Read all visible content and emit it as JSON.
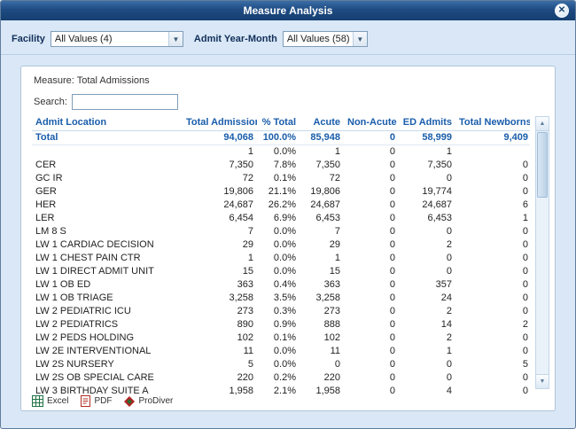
{
  "window": {
    "title": "Measure Analysis",
    "close_glyph": "✕"
  },
  "filters": {
    "facility_label": "Facility",
    "facility_value": "All Values (4)",
    "admit_label": "Admit Year-Month",
    "admit_value": "All Values (58)",
    "dropdown_arrow": "▼"
  },
  "panel": {
    "measure_label": "Measure: Total Admissions",
    "search_label": "Search:",
    "search_value": ""
  },
  "table": {
    "columns": [
      "Admit Location",
      "Total Admissions",
      "% Total",
      "Acute",
      "Non-Acute",
      "ED Admits",
      "Total Newborns"
    ],
    "total_row": [
      "Total",
      "94,068",
      "100.0%",
      "85,948",
      "0",
      "58,999",
      "9,409"
    ],
    "rows": [
      [
        "",
        "1",
        "0.0%",
        "1",
        "0",
        "1",
        ""
      ],
      [
        "CER",
        "7,350",
        "7.8%",
        "7,350",
        "0",
        "7,350",
        "0"
      ],
      [
        "GC IR",
        "72",
        "0.1%",
        "72",
        "0",
        "0",
        "0"
      ],
      [
        "GER",
        "19,806",
        "21.1%",
        "19,806",
        "0",
        "19,774",
        "0"
      ],
      [
        "HER",
        "24,687",
        "26.2%",
        "24,687",
        "0",
        "24,687",
        "6"
      ],
      [
        "LER",
        "6,454",
        "6.9%",
        "6,453",
        "0",
        "6,453",
        "1"
      ],
      [
        "LM 8 S",
        "7",
        "0.0%",
        "7",
        "0",
        "0",
        "0"
      ],
      [
        "LW 1 CARDIAC DECISION",
        "29",
        "0.0%",
        "29",
        "0",
        "2",
        "0"
      ],
      [
        "LW 1 CHEST PAIN CTR",
        "1",
        "0.0%",
        "1",
        "0",
        "0",
        "0"
      ],
      [
        "LW 1 DIRECT ADMIT UNIT",
        "15",
        "0.0%",
        "15",
        "0",
        "0",
        "0"
      ],
      [
        "LW 1 OB ED",
        "363",
        "0.4%",
        "363",
        "0",
        "357",
        "0"
      ],
      [
        "LW 1 OB TRIAGE",
        "3,258",
        "3.5%",
        "3,258",
        "0",
        "24",
        "0"
      ],
      [
        "LW 2 PEDIATRIC ICU",
        "273",
        "0.3%",
        "273",
        "0",
        "2",
        "0"
      ],
      [
        "LW 2 PEDIATRICS",
        "890",
        "0.9%",
        "888",
        "0",
        "14",
        "2"
      ],
      [
        "LW 2 PEDS HOLDING",
        "102",
        "0.1%",
        "102",
        "0",
        "2",
        "0"
      ],
      [
        "LW 2E INTERVENTIONAL",
        "11",
        "0.0%",
        "11",
        "0",
        "1",
        "0"
      ],
      [
        "LW 2S NURSERY",
        "5",
        "0.0%",
        "0",
        "0",
        "0",
        "5"
      ],
      [
        "LW 2S OB SPECIAL CARE",
        "220",
        "0.2%",
        "220",
        "0",
        "0",
        "0"
      ],
      [
        "LW 3 BIRTHDAY SUITE A",
        "1,958",
        "2.1%",
        "1,958",
        "0",
        "4",
        "0"
      ]
    ]
  },
  "scrollbar": {
    "up_glyph": "▲",
    "down_glyph": "▼"
  },
  "export": {
    "excel_label": "Excel",
    "pdf_label": "PDF",
    "prodiver_label": "ProDiver"
  },
  "colors": {
    "titlebar_blue": "#1e4b82",
    "accent_blue": "#1a5dab",
    "body_bg": "#d9e7f6",
    "panel_border": "#afc4d9",
    "excel_green": "#217346",
    "pdf_red": "#b03024"
  }
}
